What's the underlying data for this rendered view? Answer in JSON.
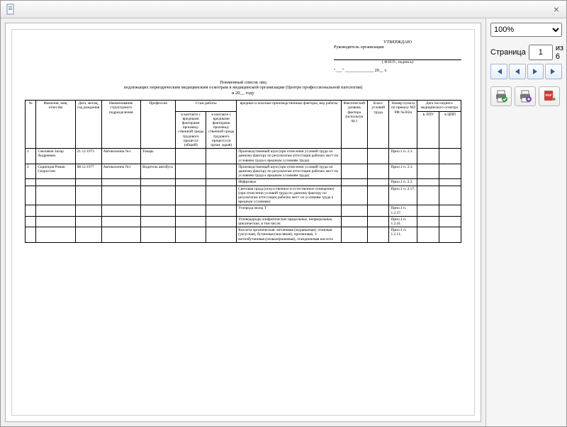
{
  "menubar": {
    "close": "×"
  },
  "side": {
    "zoom_value": "100%",
    "page_label": "Страница",
    "page_current": "1",
    "page_total_prefix": "из ",
    "page_total": "6"
  },
  "doc": {
    "approve_title": "УТВЕРЖДАЮ",
    "approve_role": "Руководитель организации",
    "approve_sign_hint": "( Ф.И.О., подпись)",
    "approve_date": "\"___\" _____________ 20__ г.",
    "title_l1": "Поименный список лиц",
    "title_l2": "подлежащих периодическим медицинским осмотрам в медицинской организации (Центре профессиональной патологии)",
    "title_l3": "в 20__ году",
    "headers": {
      "num": "№",
      "fio": "Фамилия, имя, отчество",
      "dob": "Дата, месяц, год рождения",
      "dept": "Наименование структурного подразделения",
      "prof": "Профессия",
      "stazh": "Стаж работы",
      "stazh1": "в контакте с вредными факторами производ­ственной среды трудового процесса (общий)",
      "stazh2": "в контакте с вредными факторами производ­ственной среды трудового процесса (в орган. здрав)",
      "factors": "вредные и опасные производственные факторы, вид работы",
      "class": "Фактичес­кий уровень фактора (используя пр.)",
      "cond": "Класс условий труда",
      "order": "Номер пункта по приказу МЗ РФ №302н",
      "lastmed": "Дата последнего медицинского осмотра",
      "lpu": "в ЛПУ",
      "cpp": "в ЦПП"
    },
    "rows": [
      {
        "n": "1",
        "fio": "Смеляков Захар Андреевич",
        "dob": "21.12.1973",
        "dept": "Автоколонна №1",
        "prof": "Токарь",
        "factor": "Производственный шум (при отнесении условий труда по данному фактору по результатам аттестации рабочих мест по условиям труда к вредным условиям труда)",
        "order": "Прил.1 п. 2.3."
      },
      {
        "n": "2",
        "fio": "Скрипцов Роман Скоростин",
        "dob": "08.12.1977",
        "dept": "Автоколонна №1",
        "prof": "Водитель автобуса",
        "factor": "Производственный шум (при отнесении условий труда по данному фактору по результатам аттестации рабочих мест по условиям труда к вредным условиям труда)",
        "order": "Прил.1 п. 2.3."
      },
      {
        "n": "",
        "fio": "",
        "dob": "",
        "dept": "",
        "prof": "",
        "factor": "Инфразвук",
        "order": "Прил.1 п. 2.3."
      },
      {
        "n": "",
        "fio": "",
        "dob": "",
        "dept": "",
        "prof": "",
        "factor": "Световая среда (искусственное и естественное освещение) (при отнесении условий труда по данному фактору по результатам аттестации рабочих мест по условиям труда к вредным условиям)",
        "order": "Прил.1 п. 2.17."
      },
      {
        "n": "",
        "fio": "",
        "dob": "",
        "dept": "",
        "prof": "",
        "factor": "Углерода оксид Т",
        "order": "Прил.1 п. 1.2.37."
      },
      {
        "n": "",
        "fio": "",
        "dob": "",
        "dept": "",
        "prof": "",
        "factor": "Углеводороды алифатические предельные, непредельные, циклические, в том числе:",
        "order": "Прил.1 п. 1.2.41."
      },
      {
        "n": "",
        "fio": "",
        "dob": "",
        "dept": "",
        "prof": "",
        "factor": "Кислота органическая: метановая (муравьиная), этановая (уксусная), бутановая (масляная), пропановая, 1-метилбутановая (изовалериановая), этандионовая кислота",
        "order": "Прил.1 п. 1.2.11."
      }
    ]
  }
}
